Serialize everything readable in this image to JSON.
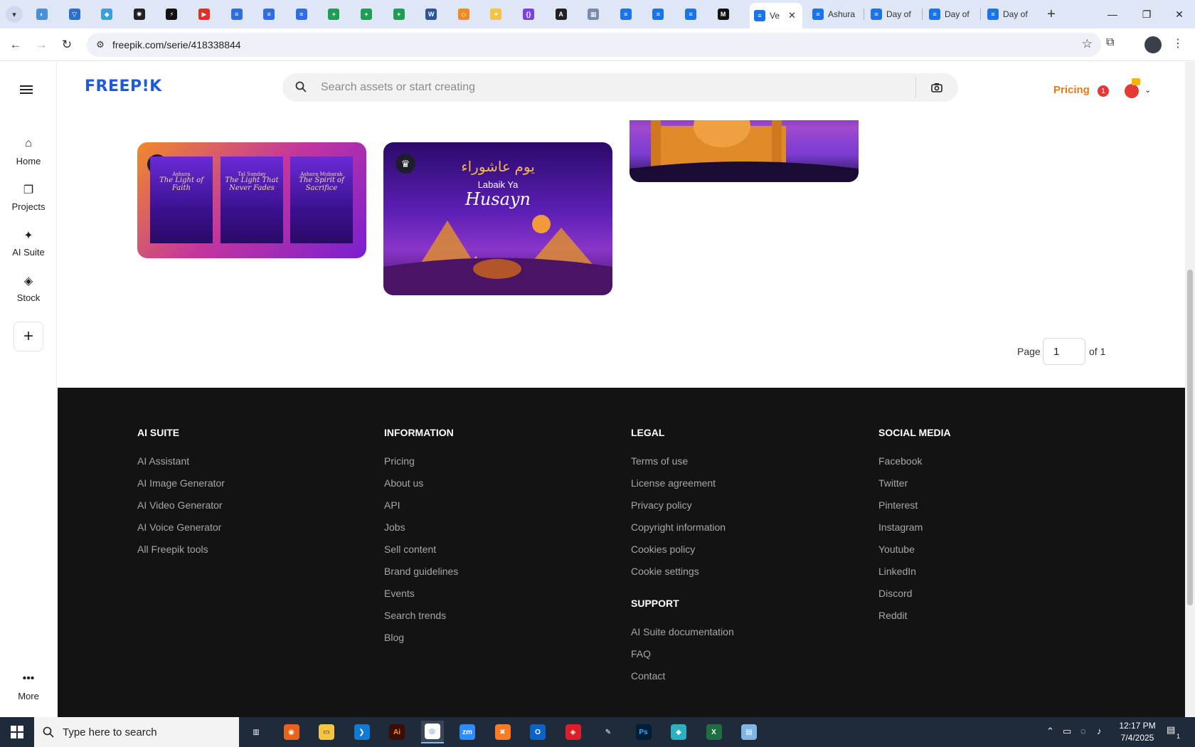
{
  "browser": {
    "pinned_tab_icons": [
      "globe-icon",
      "vpn-icon",
      "bird-icon",
      "openai-icon",
      "bolt-icon",
      "youtube-icon",
      "docs-icon",
      "docs-icon",
      "docs-icon",
      "sheets-icon",
      "sheets-icon",
      "sheets-icon",
      "word-icon",
      "drawio-icon",
      "star-icon",
      "bracket-icon",
      "ai-icon",
      "grid-icon",
      "forms-icon",
      "forms-icon",
      "forms-icon",
      "m-icon"
    ],
    "tabs": [
      {
        "label": "Ve",
        "active": true
      },
      {
        "label": "Ashura",
        "active": false
      },
      {
        "label": "Day of",
        "active": false
      },
      {
        "label": "Day of",
        "active": false
      },
      {
        "label": "Day of",
        "active": false
      }
    ],
    "new_tab": "+",
    "url": "freepik.com/serie/418338844"
  },
  "sidebar": {
    "items": [
      {
        "label": "Home",
        "icon": "home-icon"
      },
      {
        "label": "Projects",
        "icon": "projects-icon"
      },
      {
        "label": "AI Suite",
        "icon": "sparkle-icon"
      },
      {
        "label": "Stock",
        "icon": "stock-icon"
      }
    ],
    "more_label": "More"
  },
  "header": {
    "logo": "FREEP!K",
    "search_placeholder": "Search assets or start creating",
    "pricing_label": "Pricing",
    "notification_count": "1"
  },
  "cards": [
    {
      "posters": [
        {
          "kicker": "Ashura",
          "title": "The Light of Faith"
        },
        {
          "kicker": "Tal Sunday",
          "title": "The Light That Never Fades"
        },
        {
          "kicker": "Ashura Mubarak",
          "title": "The Spirit of Sacrifice"
        }
      ]
    },
    {
      "arabic": "يوم عاشوراء",
      "line1": "Labaik Ya",
      "line2": "Husayn"
    }
  ],
  "pagination": {
    "page_label": "Page",
    "current": "1",
    "of_label": "of 1"
  },
  "footer": {
    "columns": [
      {
        "heading": "AI SUITE",
        "links": [
          "AI Assistant",
          "AI Image Generator",
          "AI Video Generator",
          "AI Voice Generator",
          "All Freepik tools"
        ]
      },
      {
        "heading": "INFORMATION",
        "links": [
          "Pricing",
          "About us",
          "API",
          "Jobs",
          "Sell content",
          "Brand guidelines",
          "Events",
          "Search trends",
          "Blog"
        ]
      },
      {
        "heading": "LEGAL",
        "links": [
          "Terms of use",
          "License agreement",
          "Privacy policy",
          "Copyright information",
          "Cookies policy",
          "Cookie settings"
        ]
      },
      {
        "heading": "SOCIAL MEDIA",
        "links": [
          "Facebook",
          "Twitter",
          "Pinterest",
          "Instagram",
          "Youtube",
          "LinkedIn",
          "Discord",
          "Reddit"
        ]
      }
    ],
    "support": {
      "heading": "SUPPORT",
      "links": [
        "AI Suite documentation",
        "FAQ",
        "Contact"
      ]
    }
  },
  "taskbar": {
    "search_text": "Type here to search",
    "apps": [
      "task-view-icon",
      "firefox-icon",
      "file-explorer-icon",
      "vscode-icon",
      "illustrator-icon",
      "chrome-icon",
      "zoom-icon",
      "xampp-icon",
      "outlook-icon",
      "creative-cloud-icon",
      "pen-icon",
      "photoshop-icon",
      "app-icon",
      "excel-icon",
      "notepad-icon"
    ],
    "time": "12:17 PM",
    "date": "7/4/2025",
    "notification_count": "1"
  },
  "colors": {
    "brand": "#1f5bd8",
    "pricing": "#e27b17",
    "footer_bg": "#131313",
    "card_purple": "#5a16b5"
  }
}
